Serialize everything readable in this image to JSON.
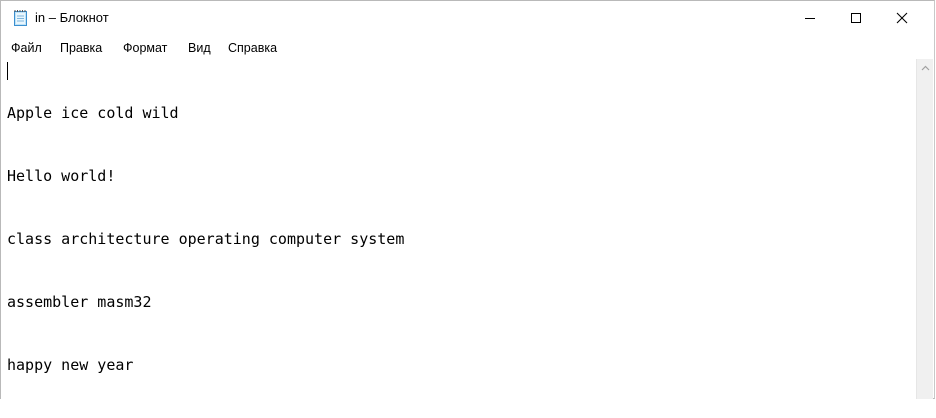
{
  "window": {
    "title": "in – Блокнот"
  },
  "menu": {
    "items": [
      "Файл",
      "Правка",
      "Формат",
      "Вид",
      "Справка"
    ]
  },
  "editor": {
    "lines": [
      "Apple ice cold wild",
      "Hello world!",
      "class architecture operating computer system",
      "assembler masm32",
      "happy new year"
    ]
  },
  "icons": {
    "app": "notepad-icon",
    "minimize": "minimize-icon",
    "maximize": "maximize-icon",
    "close": "close-icon",
    "scroll_up": "scroll-up-arrow-icon"
  },
  "colors": {
    "background": "#ffffff",
    "scrollbar": "#f0f0f0",
    "text": "#000000"
  }
}
